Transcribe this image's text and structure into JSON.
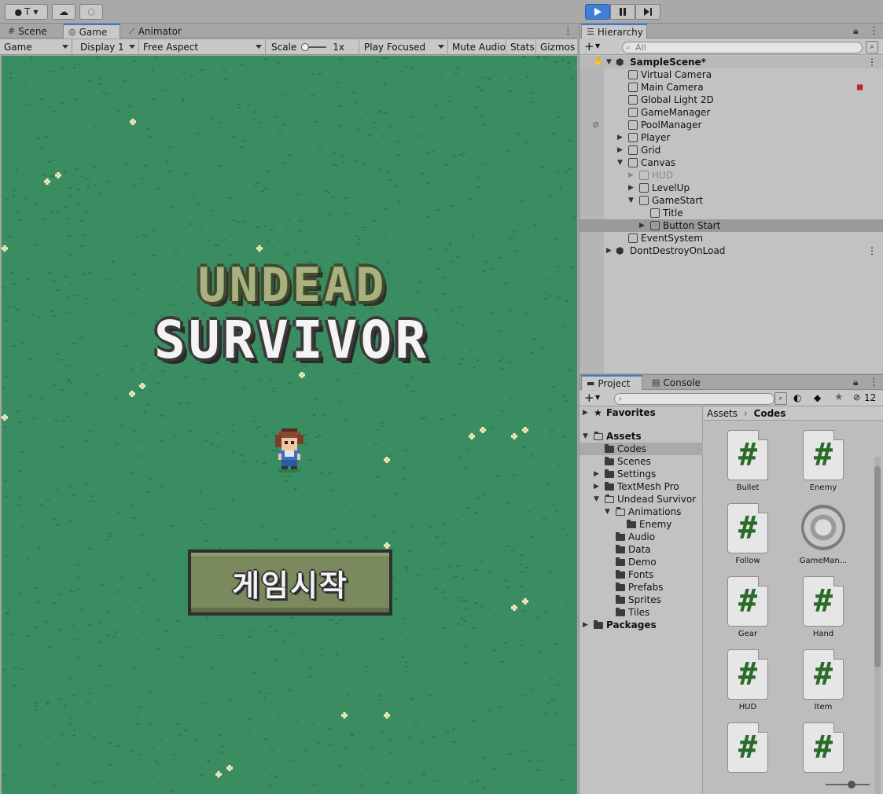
{
  "toolbar": {
    "account_label": "T",
    "play_active": true
  },
  "game_panel": {
    "tabs": [
      "Scene",
      "Game",
      "Animator"
    ],
    "active_tab": "Game",
    "toolbar": {
      "view_label": "Game",
      "display_label": "Display 1",
      "aspect_label": "Free Aspect",
      "scale_label": "Scale",
      "scale_value": "1x",
      "play_mode_label": "Play Focused",
      "mute_label": "Mute Audio",
      "stats_label": "Stats",
      "gizmos_label": "Gizmos"
    },
    "game": {
      "title_line1": "UNDEAD",
      "title_line2": "SURVIVOR",
      "start_button_label": "게임시작"
    }
  },
  "hierarchy": {
    "tab_label": "Hierarchy",
    "search_placeholder": "All",
    "items": [
      {
        "label": "SampleScene*",
        "depth": 0,
        "expanded": true,
        "type": "scene"
      },
      {
        "label": "Virtual Camera",
        "depth": 1
      },
      {
        "label": "Main Camera",
        "depth": 1
      },
      {
        "label": "Global Light 2D",
        "depth": 1
      },
      {
        "label": "GameManager",
        "depth": 1
      },
      {
        "label": "PoolManager",
        "depth": 1
      },
      {
        "label": "Player",
        "depth": 1,
        "expandable": true
      },
      {
        "label": "Grid",
        "depth": 1,
        "expandable": true
      },
      {
        "label": "Canvas",
        "depth": 1,
        "expanded": true
      },
      {
        "label": "HUD",
        "depth": 2,
        "expandable": true,
        "inactive": true
      },
      {
        "label": "LevelUp",
        "depth": 2,
        "expandable": true
      },
      {
        "label": "GameStart",
        "depth": 2,
        "expanded": true
      },
      {
        "label": "Title",
        "depth": 3
      },
      {
        "label": "Button Start",
        "depth": 3,
        "expandable": true,
        "selected": true
      },
      {
        "label": "EventSystem",
        "depth": 1
      },
      {
        "label": "DontDestroyOnLoad",
        "depth": 0,
        "expandable": true,
        "type": "scene"
      }
    ]
  },
  "project": {
    "tabs": [
      "Project",
      "Console"
    ],
    "active_tab": "Project",
    "hidden_count": "12",
    "tree": [
      {
        "label": "Favorites",
        "depth": 0,
        "bold": true,
        "expandable": true,
        "icon": "star"
      },
      {
        "label": "Assets",
        "depth": 0,
        "bold": true,
        "expanded": true
      },
      {
        "label": "Codes",
        "depth": 1,
        "selected": true
      },
      {
        "label": "Scenes",
        "depth": 1
      },
      {
        "label": "Settings",
        "depth": 1,
        "expandable": true
      },
      {
        "label": "TextMesh Pro",
        "depth": 1,
        "expandable": true
      },
      {
        "label": "Undead Survivor",
        "depth": 1,
        "expanded": true
      },
      {
        "label": "Animations",
        "depth": 2,
        "expanded": true
      },
      {
        "label": "Enemy",
        "depth": 3
      },
      {
        "label": "Audio",
        "depth": 2
      },
      {
        "label": "Data",
        "depth": 2
      },
      {
        "label": "Demo",
        "depth": 2
      },
      {
        "label": "Fonts",
        "depth": 2
      },
      {
        "label": "Prefabs",
        "depth": 2
      },
      {
        "label": "Sprites",
        "depth": 2
      },
      {
        "label": "Tiles",
        "depth": 2
      },
      {
        "label": "Packages",
        "depth": 0,
        "bold": true,
        "expandable": true
      }
    ],
    "breadcrumb": [
      "Assets",
      "Codes"
    ],
    "assets": [
      {
        "label": "Bullet",
        "kind": "script"
      },
      {
        "label": "Enemy",
        "kind": "script"
      },
      {
        "label": "Follow",
        "kind": "script"
      },
      {
        "label": "GameMan...",
        "kind": "gear"
      },
      {
        "label": "Gear",
        "kind": "script"
      },
      {
        "label": "Hand",
        "kind": "script"
      },
      {
        "label": "HUD",
        "kind": "script"
      },
      {
        "label": "Item",
        "kind": "script"
      },
      {
        "label": "",
        "kind": "script"
      },
      {
        "label": "",
        "kind": "script"
      }
    ]
  }
}
